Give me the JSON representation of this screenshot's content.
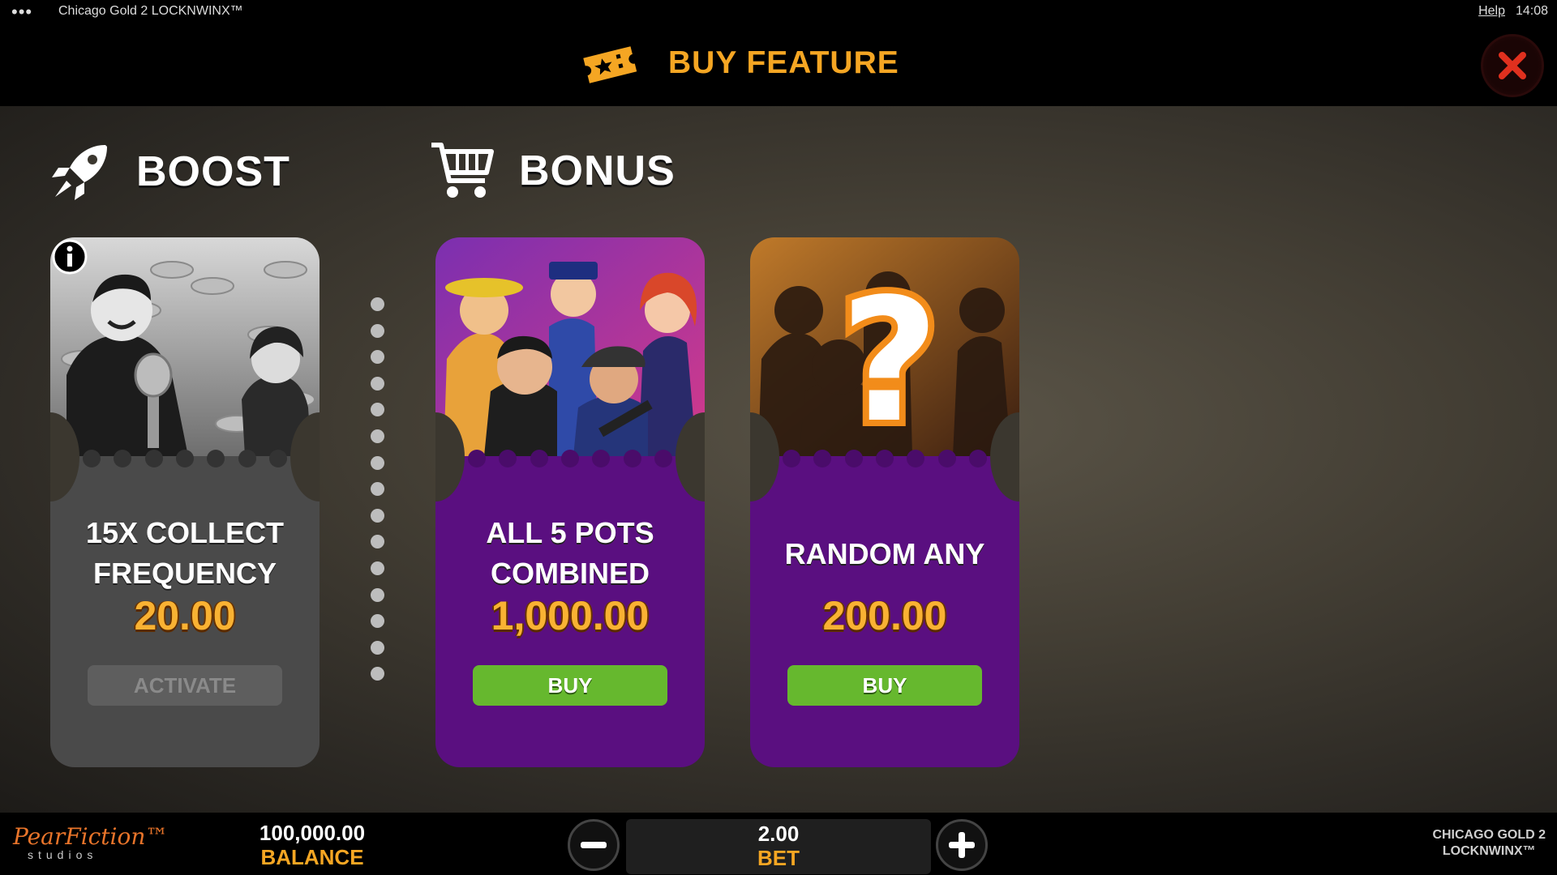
{
  "topbar": {
    "menu_dots": "•••",
    "app_title": "Chicago Gold 2 LOCKNWINX™",
    "help_link": "Help",
    "clock": "14:08"
  },
  "header": {
    "title": "BUY FEATURE",
    "ticket_icon": "ticket-icon",
    "close_icon": "close-icon"
  },
  "sections": {
    "boost_label": "BOOST",
    "boost_icon": "rocket-icon",
    "bonus_label": "BONUS",
    "bonus_icon": "shopping-cart-icon"
  },
  "cards": [
    {
      "title": "15X COLLECT FREQUENCY",
      "price": "20.00",
      "button": "ACTIVATE",
      "style": "grey",
      "has_info_icon": true
    },
    {
      "title": "ALL 5 POTS COMBINED",
      "price": "1,000.00",
      "button": "BUY",
      "style": "purple"
    },
    {
      "title": "RANDOM ANY",
      "price": "200.00",
      "button": "BUY",
      "style": "purple"
    }
  ],
  "bottombar": {
    "logo_brand": "PearFiction™",
    "logo_sub": "studios",
    "balance_value": "100,000.00",
    "balance_label": "BALANCE",
    "bet_value": "2.00",
    "bet_label": "BET",
    "game_logo_line1": "CHICAGO GOLD 2",
    "game_logo_line2": "LOCKNWINX™"
  },
  "colors": {
    "accent_orange": "#f5a623",
    "price_gold": "#f9b233",
    "buy_green": "#66b82e",
    "card_purple": "#5a0f80",
    "card_grey": "#4a4a4a",
    "close_red": "#e0301e"
  }
}
